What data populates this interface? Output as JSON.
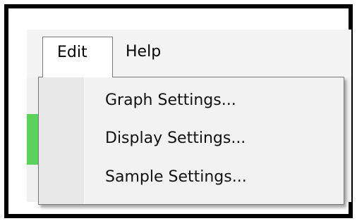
{
  "menubar": {
    "menus": [
      {
        "label": "Edit"
      },
      {
        "label": "Help"
      }
    ]
  },
  "edit_menu": {
    "items": [
      {
        "label": "Graph Settings..."
      },
      {
        "label": "Display Settings..."
      },
      {
        "label": "Sample Settings..."
      }
    ]
  },
  "colors": {
    "accent_strip": "#5cd15c",
    "border": "#000000",
    "menu_background": "#f2f2f2"
  }
}
